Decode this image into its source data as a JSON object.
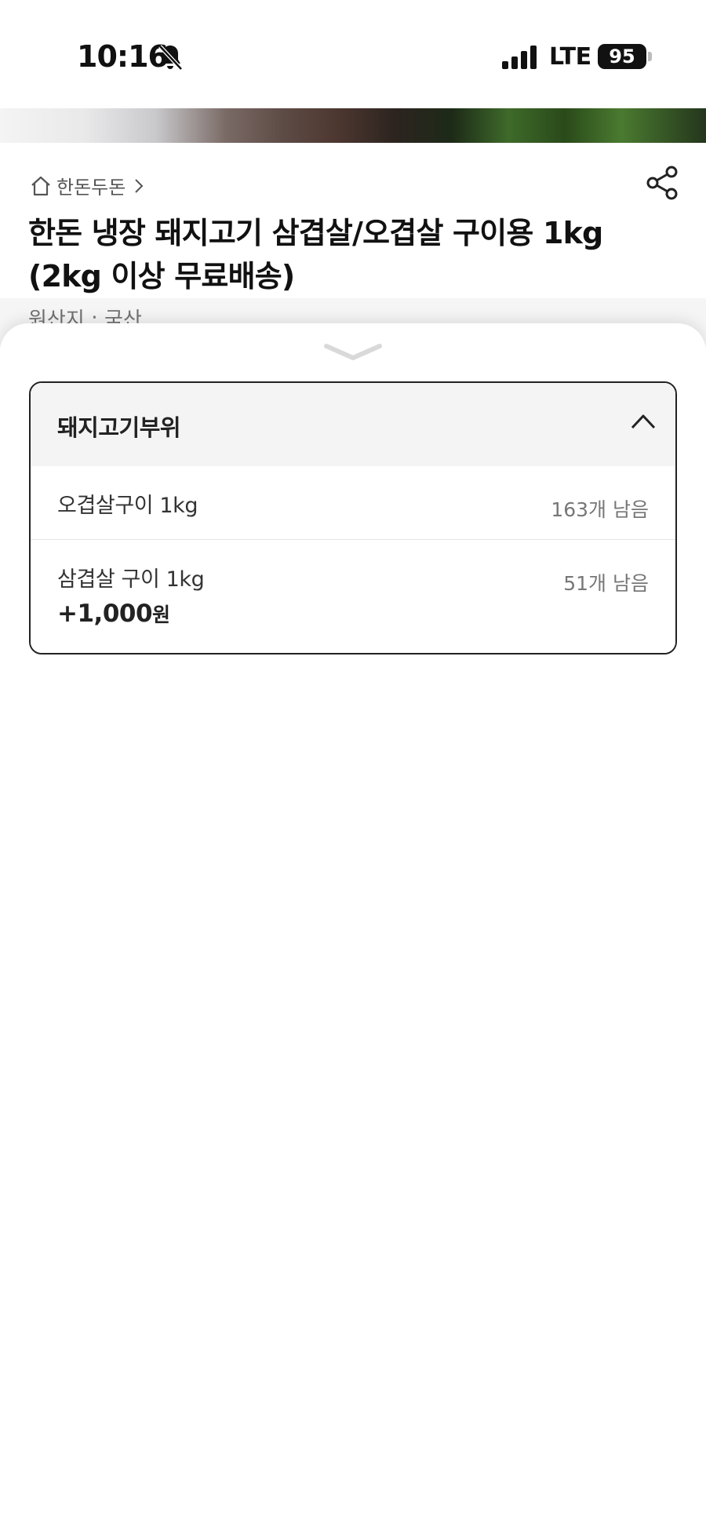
{
  "status_bar": {
    "time": "10:16",
    "network": "LTE",
    "battery": "95"
  },
  "product": {
    "breadcrumb": "한돈두돈",
    "title": "한돈 냉장 돼지고기 삼겹살/오겹살 구이용 1kg (2kg 이상 무료배송)",
    "origin": "원산지 : 국산"
  },
  "option_sheet": {
    "group_label": "돼지고기부위",
    "options": [
      {
        "name": "오겹살구이 1kg",
        "stock": "163개 남음",
        "extra_price": ""
      },
      {
        "name": "삼겹살 구이 1kg",
        "stock": "51개 남음",
        "extra_price": "+1,000",
        "extra_unit": "원"
      }
    ]
  },
  "icons": {
    "bell": "bell-slash-icon",
    "signal": "signal-bars-icon",
    "home": "home-icon",
    "share": "share-icon",
    "handle": "chevron-down-icon",
    "collapse": "chevron-up-icon"
  },
  "colors": {
    "text_primary": "#111111",
    "text_secondary": "#777777",
    "header_bg": "#f4f4f4",
    "border": "#222222"
  }
}
